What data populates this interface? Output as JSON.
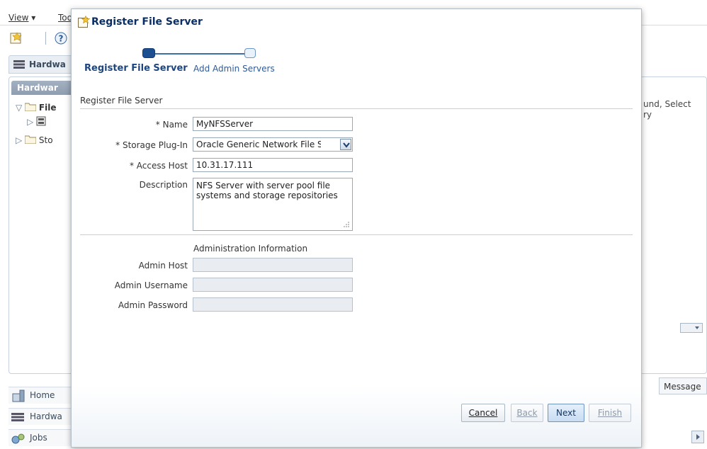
{
  "background": {
    "menus": [
      "View",
      "Too"
    ],
    "panel_title": "Hardwa",
    "subpanel_title": "Hardwar",
    "tree_items": [
      "File",
      "Sto"
    ],
    "right_text": [
      "und, Select",
      "ry"
    ],
    "message_col": "Message",
    "bottom_nav": [
      "Home",
      "Hardwa",
      "Jobs"
    ]
  },
  "dialog": {
    "title": "Register File Server",
    "train": {
      "step1": "Register File Server",
      "step2": "Add Admin Servers"
    },
    "section_title": "Register File Server",
    "fields": {
      "name_label": "* Name",
      "name_value": "MyNFSServer",
      "plugin_label": "* Storage Plug-In",
      "plugin_value": "Oracle Generic Network File Sys",
      "host_label": "* Access Host",
      "host_value": "10.31.17.111",
      "desc_label": "Description",
      "desc_value": "NFS Server with server pool file systems and storage repositories"
    },
    "admin": {
      "title": "Administration Information",
      "host_label": "Admin Host",
      "user_label": "Admin Username",
      "pass_label": "Admin Password"
    },
    "buttons": {
      "cancel": "Cancel",
      "back": "Back",
      "next": "Next",
      "finish": "Finish"
    }
  }
}
